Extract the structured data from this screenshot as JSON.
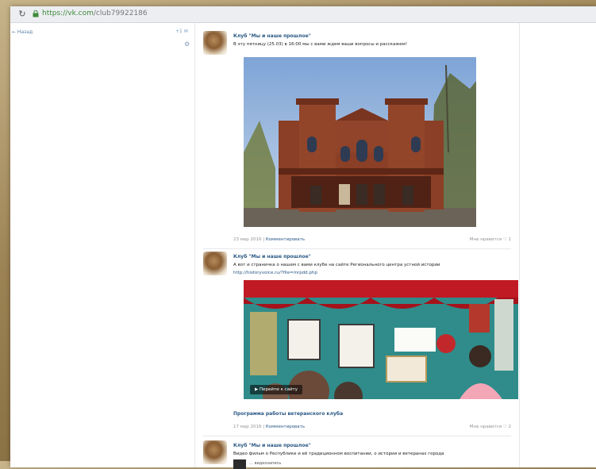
{
  "browser": {
    "url_host": "https://vk.com",
    "url_path": "/club79922186"
  },
  "left_nav": {
    "back_label": "← Назад",
    "badge": "+1 ✉"
  },
  "posts": [
    {
      "author": "Клуб \"Мы и наше прошлое\"",
      "text": "В эту пятницу (25.03) в 16:00 мы с вами ждем ваши вопросы и расскажем!",
      "date": "23 мар 2016",
      "comment_label": "Комментировать",
      "like_label": "Мне нравится ♡ 1"
    },
    {
      "author": "Клуб \"Мы и наше прошлое\"",
      "text": "А вот и страничка о нашем с вами клубе на сайте Регионального центра устной истории",
      "link": "http://historyvoice.ru/?file=mrpdd.php",
      "photo_tag": "▶ Перейти к сайту",
      "caption": "Программа работы ветеранского клуба",
      "date": "17 мар 2016",
      "comment_label": "Комментировать",
      "like_label": "Мне нравится ♡ 2"
    },
    {
      "author": "Клуб \"Мы и наше прошлое\"",
      "text": "Видео фильм о Республике и её традиционном воспитании, о истории и ветеранах города",
      "thumb_text": "… видеозапись"
    }
  ],
  "colors": {
    "link": "#2a5885",
    "meta": "#939393",
    "url_secure": "#3e8a3a"
  }
}
